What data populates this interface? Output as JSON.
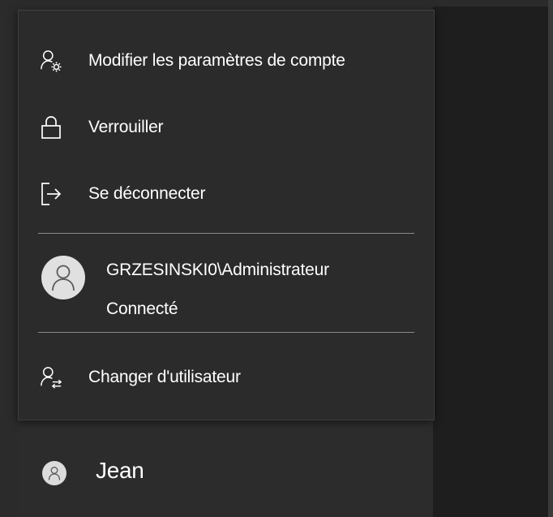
{
  "menu": {
    "items": [
      {
        "label": "Modifier les paramètres de compte",
        "icon": "account-settings-icon"
      },
      {
        "label": "Verrouiller",
        "icon": "lock-icon"
      },
      {
        "label": "Se déconnecter",
        "icon": "sign-out-icon"
      }
    ],
    "account": {
      "name": "GRZESINSKI0\\Administrateur",
      "status": "Connecté",
      "icon": "user-avatar-icon"
    },
    "switch_user": {
      "label": "Changer d'utilisateur",
      "icon": "switch-user-icon"
    }
  },
  "current_user": {
    "name": "Jean",
    "icon": "user-avatar-icon"
  },
  "colors": {
    "flyout_bg": "#2b2b2b",
    "text": "#ffffff",
    "divider": "#8a8a8a",
    "avatar": "#e0e0e0"
  }
}
